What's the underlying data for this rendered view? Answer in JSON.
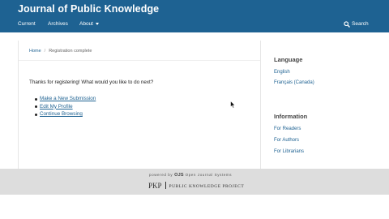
{
  "header": {
    "site_title": "Journal of Public Knowledge"
  },
  "nav": {
    "current": "Current",
    "archives": "Archives",
    "about": "About",
    "search": "Search"
  },
  "breadcrumb": {
    "home": "Home",
    "separator": "/",
    "current": "Registration complete"
  },
  "main": {
    "message": "Thanks for registering! What would you like to do next?",
    "options": [
      "Make a New Submission",
      "Edit My Profile",
      "Continue Browsing"
    ]
  },
  "sidebar": {
    "language_title": "Language",
    "languages": [
      "English",
      "Français (Canada)"
    ],
    "information_title": "Information",
    "information_links": [
      "For Readers",
      "For Authors",
      "For Librarians"
    ]
  },
  "footer": {
    "powered_by": "powered by",
    "ojs": "OJS",
    "ojs_full": "Open Journal Systems",
    "pkp": "PKP",
    "pkp_full": "PUBLIC KNOWLEDGE PROJECT"
  },
  "colors": {
    "header_bg": "#1e6292",
    "link": "#1e6292",
    "footer_bg": "#dddddd"
  }
}
